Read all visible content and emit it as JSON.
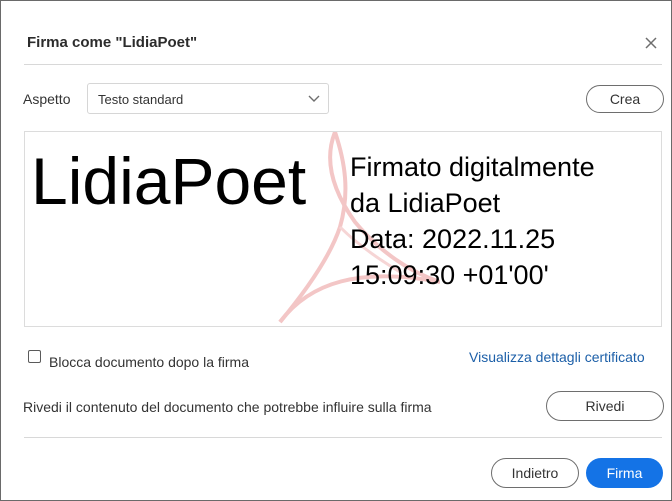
{
  "dialog": {
    "title": "Firma come \"LidiaPoet\"",
    "close_icon": "close-icon"
  },
  "appearance": {
    "label": "Aspetto",
    "selected": "Testo standard",
    "create_label": "Crea"
  },
  "preview": {
    "name": "LidiaPoet",
    "details": [
      "Firmato digitalmente",
      "da LidiaPoet",
      "Data: 2022.11.25",
      "15:09:30 +01'00'"
    ],
    "watermark": "acrobat-logo-watermark"
  },
  "options": {
    "lock_label": "Blocca documento dopo la firma",
    "lock_checked": false,
    "cert_link": "Visualizza dettagli certificato"
  },
  "review": {
    "text": "Rivedi il contenuto del documento che potrebbe influire sulla firma",
    "button": "Rivedi"
  },
  "footer": {
    "back": "Indietro",
    "sign": "Firma"
  },
  "colors": {
    "accent": "#1473e6",
    "link": "#1c5fa8",
    "watermark": "#f3c6c6"
  }
}
